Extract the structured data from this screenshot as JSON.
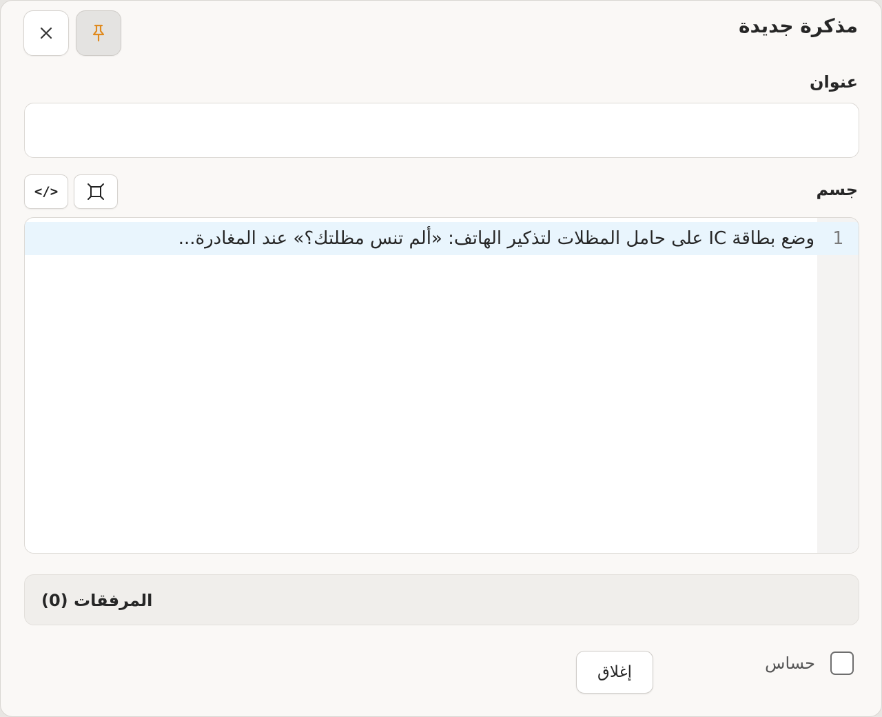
{
  "dialog": {
    "title": "مذكرة جديدة"
  },
  "header_buttons": {
    "close_icon": "close-icon",
    "pin_icon": "pin-icon",
    "pin_color": "#e08a1e"
  },
  "fields": {
    "title_label": "عنوان",
    "title_value": "",
    "body_label": "جسم"
  },
  "editor": {
    "code_toggle_glyph": "</>",
    "lines": [
      {
        "number": "1",
        "text": "وضع بطاقة IC على حامل المظلات لتذكير الهاتف: «ألم تنس مظلتك؟» عند المغادرة..."
      }
    ]
  },
  "attachments": {
    "label": "المرفقات (0)"
  },
  "footer": {
    "sensitive_label": "حساس",
    "sensitive_checked": false,
    "close_label": "إغلاق"
  }
}
